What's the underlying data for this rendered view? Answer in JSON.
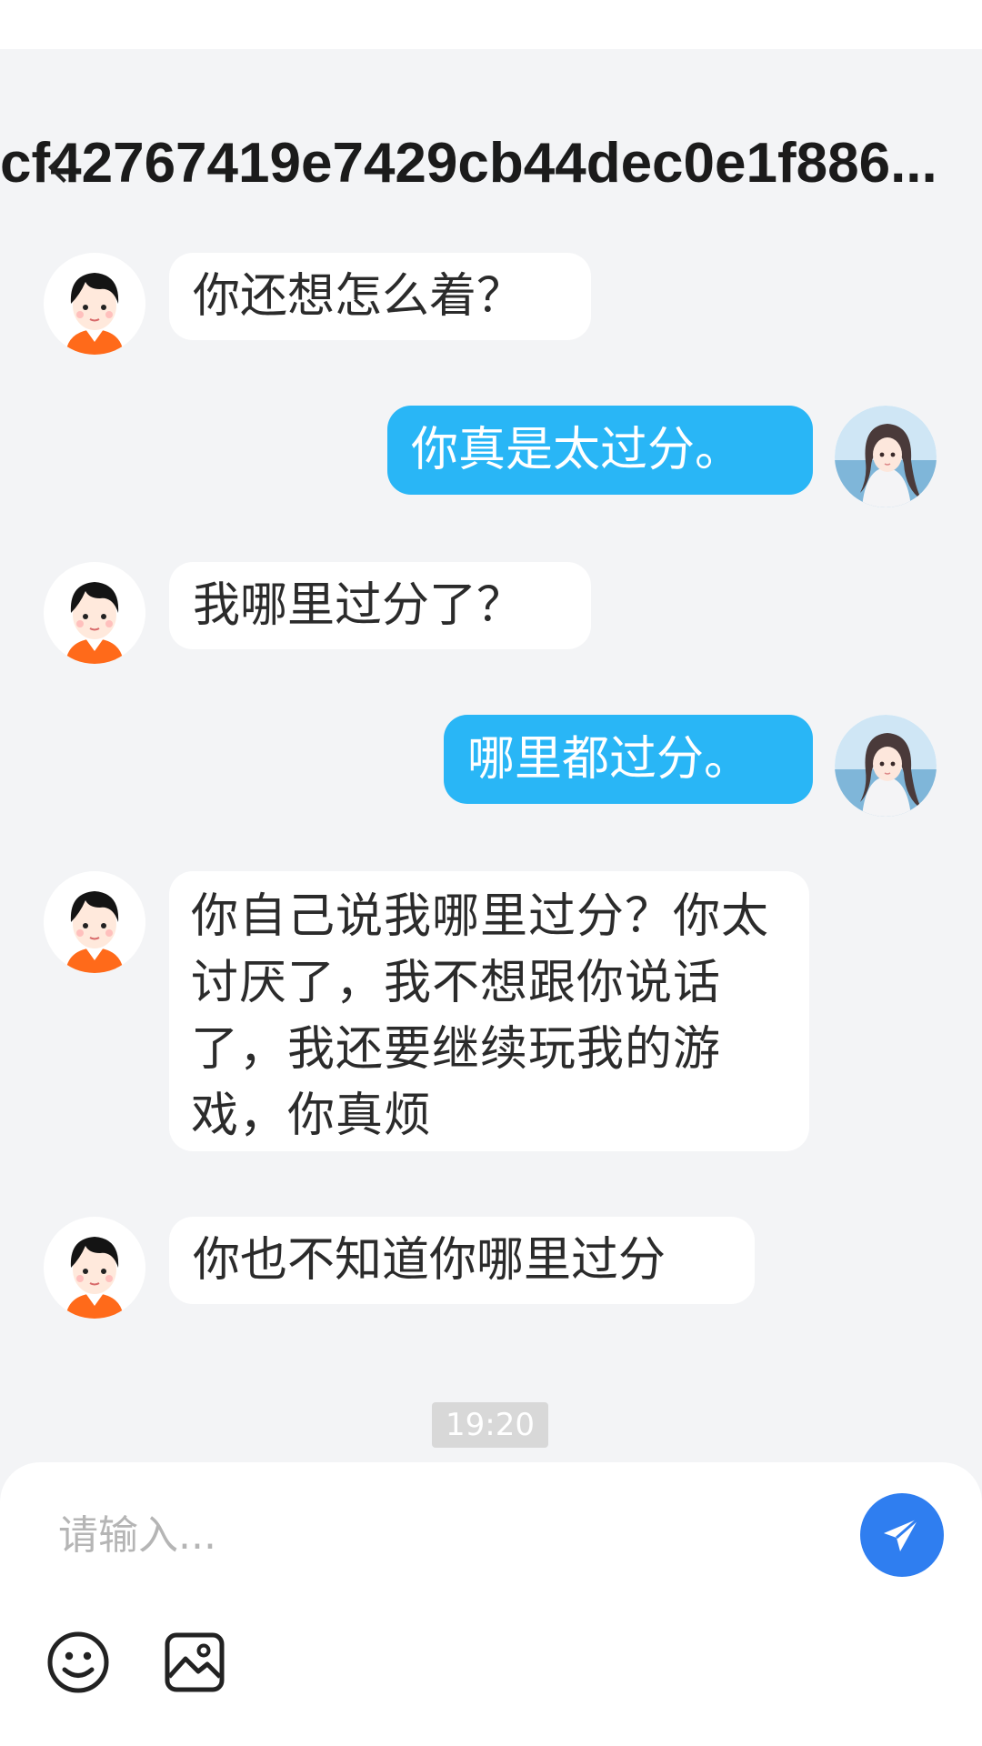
{
  "chat": {
    "title": "cf42767419e7429cb44dec0e1f886..."
  },
  "messages": [
    {
      "side": "in",
      "text": "你还想怎么着？"
    },
    {
      "side": "out",
      "text": "你真是太过分。"
    },
    {
      "side": "in",
      "text": "我哪里过分了？"
    },
    {
      "side": "out",
      "text": "哪里都过分。"
    },
    {
      "side": "in",
      "text": "你自己说我哪里过分？你太讨厌了，我不想跟你说话了，我还要继续玩我的游戏，你真烦"
    },
    {
      "side": "in",
      "text": "你也不知道你哪里过分"
    }
  ],
  "timestamp": "19:20",
  "composer": {
    "placeholder": "请输入...",
    "icons": {
      "send": "paper-plane-icon",
      "emoji": "smiley-icon",
      "image": "image-icon"
    }
  },
  "colors": {
    "background": "#f3f4f6",
    "outgoing_bubble": "#29b6f6",
    "incoming_bubble": "#ffffff",
    "send_button": "#2f7ef0",
    "timestamp_bg": "#d8d8d8"
  }
}
